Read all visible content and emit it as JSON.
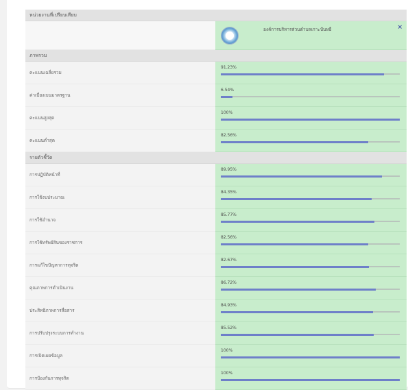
{
  "header": {
    "title": "หน่วยงานที่เปรียบเทียบ"
  },
  "org": {
    "name": "องค์การบริหารส่วนตำบลเกาะปันหยี",
    "close_label": "×"
  },
  "overview": {
    "title": "ภาพรวม",
    "rows": [
      {
        "label": "คะแนนเฉลี่ยรวม",
        "value_text": "91.23%",
        "value": 91.23
      },
      {
        "label": "ค่าเบี่ยงเบนมาตรฐาน",
        "value_text": "6.54%",
        "value": 6.54
      },
      {
        "label": "คะแนนสูงสุด",
        "value_text": "100%",
        "value": 100
      },
      {
        "label": "คะแนนต่ำสุด",
        "value_text": "82.56%",
        "value": 82.56
      }
    ]
  },
  "indicators": {
    "title": "รายตัวชี้วัด",
    "rows": [
      {
        "label": "การปฏิบัติหน้าที่",
        "value_text": "89.95%",
        "value": 89.95
      },
      {
        "label": "การใช้งบประมาณ",
        "value_text": "84.35%",
        "value": 84.35
      },
      {
        "label": "การใช้อำนาจ",
        "value_text": "85.77%",
        "value": 85.77
      },
      {
        "label": "การใช้ทรัพย์สินของราชการ",
        "value_text": "82.56%",
        "value": 82.56
      },
      {
        "label": "การแก้ไขปัญหาการทุจริต",
        "value_text": "82.67%",
        "value": 82.67
      },
      {
        "label": "คุณภาพการดำเนินงาน",
        "value_text": "86.72%",
        "value": 86.72
      },
      {
        "label": "ประสิทธิภาพการสื่อสาร",
        "value_text": "84.93%",
        "value": 84.93
      },
      {
        "label": "การปรับปรุงระบบการทำงาน",
        "value_text": "85.52%",
        "value": 85.52
      },
      {
        "label": "การเปิดเผยข้อมูล",
        "value_text": "100%",
        "value": 100
      },
      {
        "label": "การป้องกันการทุจริต",
        "value_text": "100%",
        "value": 100
      }
    ]
  },
  "colors": {
    "bar_fill": "#6e7fc9",
    "value_bg": "#c8edcc",
    "header_bg": "#e2e2e2"
  }
}
